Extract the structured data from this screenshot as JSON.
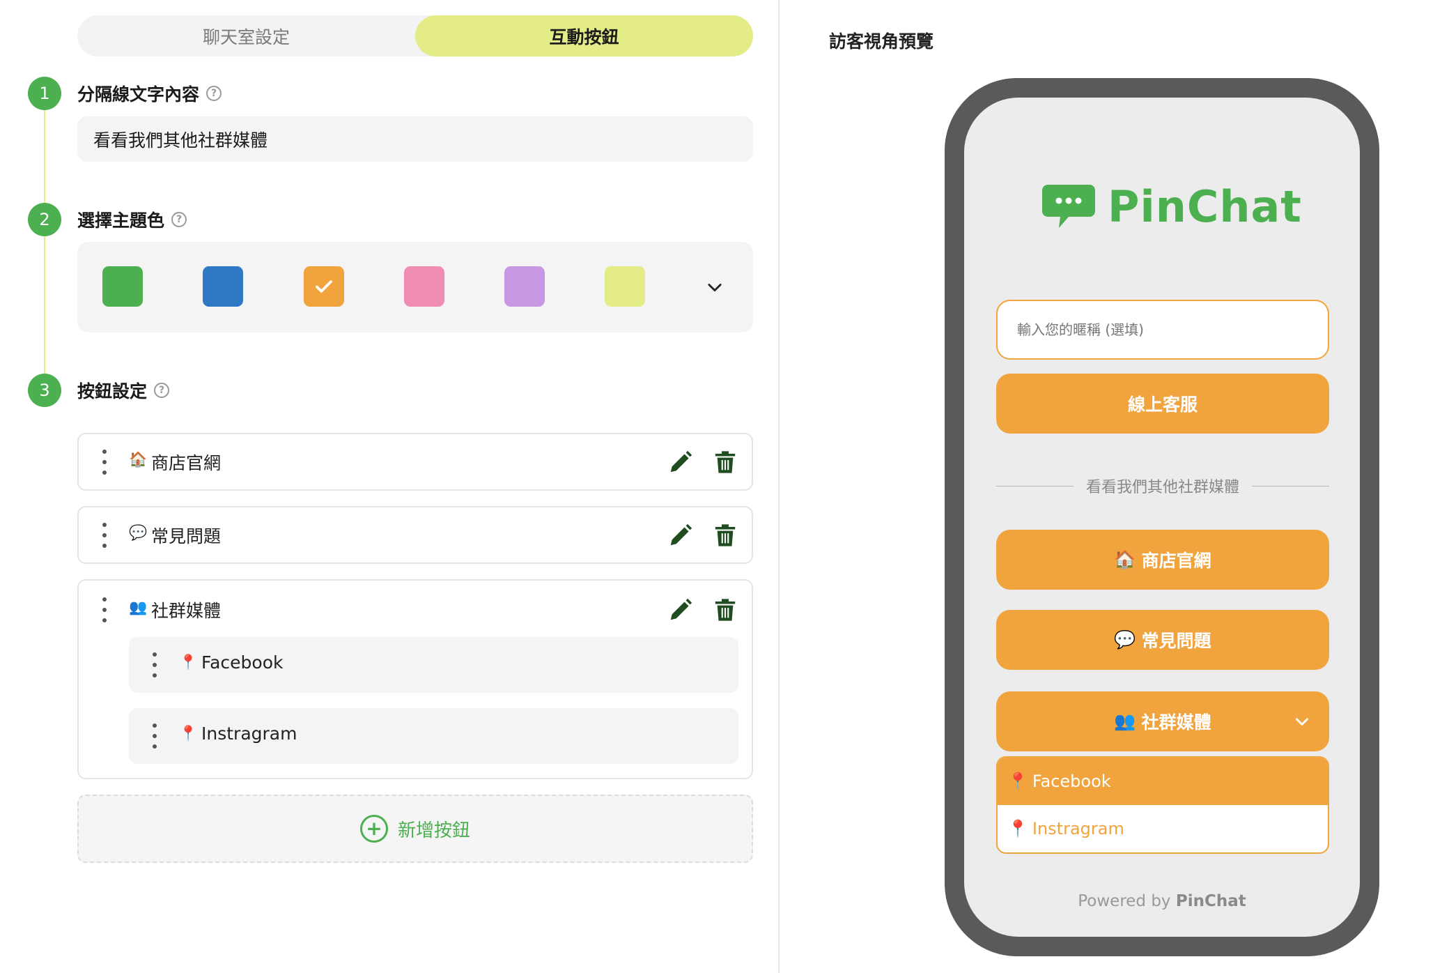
{
  "tabs": {
    "chat_settings": "聊天室設定",
    "interactive_buttons": "互動按鈕"
  },
  "steps": {
    "s1": {
      "num": "1",
      "title": "分隔線文字內容",
      "help": "?",
      "input_value": "看看我們其他社群媒體"
    },
    "s2": {
      "num": "2",
      "title": "選擇主題色",
      "help": "?"
    },
    "s3": {
      "num": "3",
      "title": "按鈕設定",
      "help": "?"
    }
  },
  "theme_colors": {
    "swatches": [
      "#4caf50",
      "#2f78c3",
      "#f1a43d",
      "#f08cb2",
      "#c897e3",
      "#e4ec88"
    ],
    "selected": "#f1a43d"
  },
  "buttons": [
    {
      "emoji": "🏠",
      "label": "商店官網"
    },
    {
      "emoji": "💬",
      "label": "常見問題"
    },
    {
      "emoji": "👥",
      "label": "社群媒體",
      "children": [
        {
          "emoji": "📍",
          "label": "Facebook"
        },
        {
          "emoji": "📍",
          "label": "Instragram"
        }
      ]
    }
  ],
  "add_button_label": "新增按鈕",
  "preview": {
    "title": "訪客視角預覽",
    "brand": "PinChat",
    "nickname_placeholder": "輸入您的暱稱 (選填)",
    "primary_button": "線上客服",
    "separator_text": "看看我們其他社群媒體",
    "buttons": [
      {
        "emoji": "🏠",
        "label": "商店官網"
      },
      {
        "emoji": "💬",
        "label": "常見問題"
      },
      {
        "emoji": "👥",
        "label": "社群媒體"
      }
    ],
    "dropdown": [
      {
        "emoji": "📍",
        "label": "Facebook"
      },
      {
        "emoji": "📍",
        "label": "Instragram"
      }
    ],
    "powered_prefix": "Powered by",
    "powered_brand": "PinChat"
  },
  "colors": {
    "accent_green": "#4caf50",
    "accent_yellow": "#e4ec88",
    "theme_orange": "#f1a43d"
  }
}
